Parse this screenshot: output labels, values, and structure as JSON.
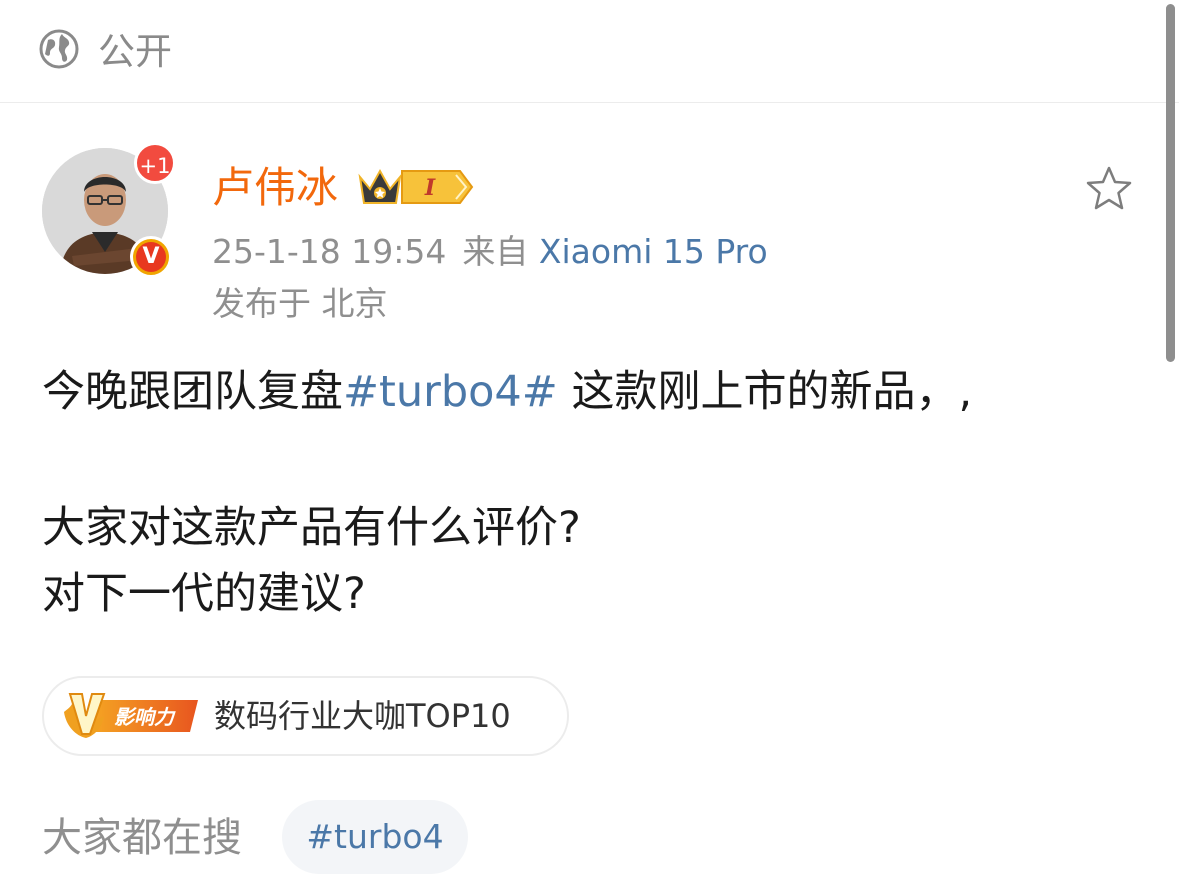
{
  "visibility": {
    "label": "公开",
    "icon": "globe-icon"
  },
  "author": {
    "name": "卢伟冰",
    "plus_badge": "+1",
    "verified_mark": "V",
    "level_badge": "I",
    "avatar": "avatar-photo"
  },
  "meta": {
    "time": "25-1-18 19:54",
    "from_label": "来自",
    "device": "Xiaomi 15 Pro",
    "location": "发布于 北京"
  },
  "post": {
    "line1_prefix": "今晚跟团队复盘",
    "topic": "#turbo4#",
    "line1_suffix": " 这款刚上市的新品，,",
    "line2": "大家对这款产品有什么评价?",
    "line3": "对下一代的建议?"
  },
  "influence": {
    "badge_text": "影响力",
    "badge_letter": "V",
    "label": "数码行业大咖TOP10"
  },
  "trending": {
    "label": "大家都在搜",
    "chip": "#turbo4"
  },
  "colors": {
    "name_orange": "#f2680c",
    "link_blue": "#4b78a8",
    "meta_gray": "#8f8f8f"
  }
}
